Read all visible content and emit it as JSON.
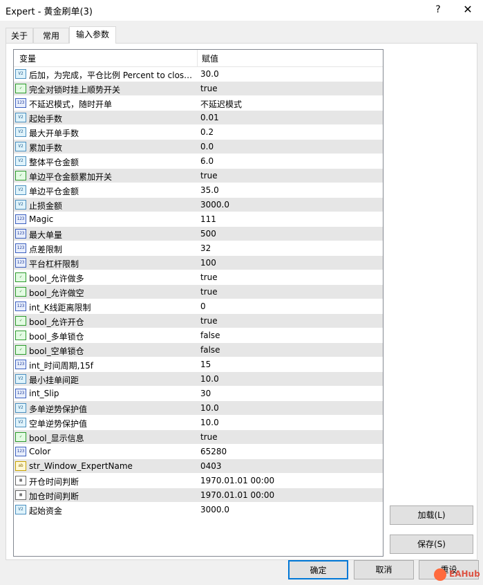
{
  "window": {
    "title": "Expert - 黄金刷单(3)",
    "help_glyph": "?",
    "close_glyph": "✕"
  },
  "tabs": [
    {
      "label": "关于",
      "active": false
    },
    {
      "label": "常用",
      "active": false
    },
    {
      "label": "输入参数",
      "active": true
    }
  ],
  "table": {
    "headers": {
      "variable": "变量",
      "value": "赋值"
    },
    "rows": [
      {
        "icon": "double-icon",
        "name": "后加，为完成，平仓比例 Percent to close...",
        "value": "30.0"
      },
      {
        "icon": "bool-icon",
        "name": "完全对锁时挂上顺势开关",
        "value": "true"
      },
      {
        "icon": "int-icon",
        "name": "不延迟模式，随时开单",
        "value": "不延迟模式"
      },
      {
        "icon": "double-icon",
        "name": "起始手数",
        "value": "0.01"
      },
      {
        "icon": "double-icon",
        "name": "最大开单手数",
        "value": "0.2"
      },
      {
        "icon": "double-icon",
        "name": "累加手数",
        "value": "0.0"
      },
      {
        "icon": "double-icon",
        "name": "整体平仓金额",
        "value": "6.0"
      },
      {
        "icon": "bool-icon",
        "name": "单边平仓金额累加开关",
        "value": "true"
      },
      {
        "icon": "double-icon",
        "name": "单边平仓金额",
        "value": "35.0"
      },
      {
        "icon": "double-icon",
        "name": "止损金额",
        "value": "3000.0"
      },
      {
        "icon": "int-icon",
        "name": "Magic",
        "value": "111"
      },
      {
        "icon": "int-icon",
        "name": "最大单量",
        "value": "500"
      },
      {
        "icon": "int-icon",
        "name": "点差限制",
        "value": "32"
      },
      {
        "icon": "int-icon",
        "name": "平台杠杆限制",
        "value": "100"
      },
      {
        "icon": "bool-icon",
        "name": "bool_允许做多",
        "value": "true"
      },
      {
        "icon": "bool-icon",
        "name": "bool_允许做空",
        "value": "true"
      },
      {
        "icon": "int-icon",
        "name": "int_K线距离限制",
        "value": "0"
      },
      {
        "icon": "bool-icon",
        "name": "bool_允许开仓",
        "value": "true"
      },
      {
        "icon": "bool-icon",
        "name": "bool_多单锁仓",
        "value": "false"
      },
      {
        "icon": "bool-icon",
        "name": "bool_空单锁仓",
        "value": "false"
      },
      {
        "icon": "int-icon",
        "name": "int_时间周期,15f",
        "value": "15"
      },
      {
        "icon": "double-icon",
        "name": "最小挂单间距",
        "value": "10.0"
      },
      {
        "icon": "int-icon",
        "name": "int_Slip",
        "value": "30"
      },
      {
        "icon": "double-icon",
        "name": "多单逆势保护值",
        "value": "10.0"
      },
      {
        "icon": "double-icon",
        "name": "空单逆势保护值",
        "value": "10.0"
      },
      {
        "icon": "bool-icon",
        "name": "bool_显示信息",
        "value": "true"
      },
      {
        "icon": "int-icon",
        "name": "Color",
        "value": "65280"
      },
      {
        "icon": "string-icon",
        "name": "str_Window_ExpertName",
        "value": "0403"
      },
      {
        "icon": "datetime-icon",
        "name": "开仓时间判断",
        "value": "1970.01.01 00:00"
      },
      {
        "icon": "datetime-icon",
        "name": "加仓时间判断",
        "value": "1970.01.01 00:00"
      },
      {
        "icon": "double-icon",
        "name": "起始资金",
        "value": "3000.0"
      }
    ]
  },
  "buttons": {
    "load": "加载(L)",
    "save": "保存(S)",
    "ok": "确定",
    "cancel": "取消",
    "reset": "重设"
  },
  "watermark": {
    "text": "EAHub"
  },
  "colors": {
    "accent": "#0078d7",
    "alt_row": "#e6e6e6",
    "panel_bg": "#ffffff",
    "window_bg": "#f0f0f0"
  }
}
